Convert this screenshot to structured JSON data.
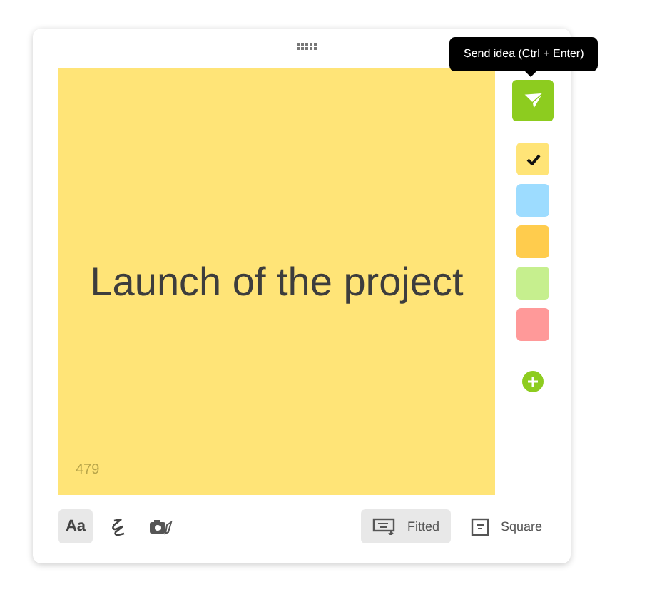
{
  "note": {
    "text": "Launch of the project",
    "color": "#ffe477",
    "counter": "479"
  },
  "send": {
    "tooltip": "Send idea (Ctrl + Enter)"
  },
  "swatches": [
    {
      "color": "#ffe477",
      "selected": true
    },
    {
      "color": "#9ddcff",
      "selected": false
    },
    {
      "color": "#ffcc4d",
      "selected": false
    },
    {
      "color": "#c6ef8e",
      "selected": false
    },
    {
      "color": "#ff9999",
      "selected": false
    }
  ],
  "tools": [
    {
      "kind": "text",
      "label": "Aa",
      "selected": true
    },
    {
      "kind": "draw",
      "selected": false
    },
    {
      "kind": "photo",
      "selected": false
    }
  ],
  "shapes": [
    {
      "kind": "fitted",
      "label": "Fitted",
      "selected": true
    },
    {
      "kind": "square",
      "label": "Square",
      "selected": false
    }
  ]
}
